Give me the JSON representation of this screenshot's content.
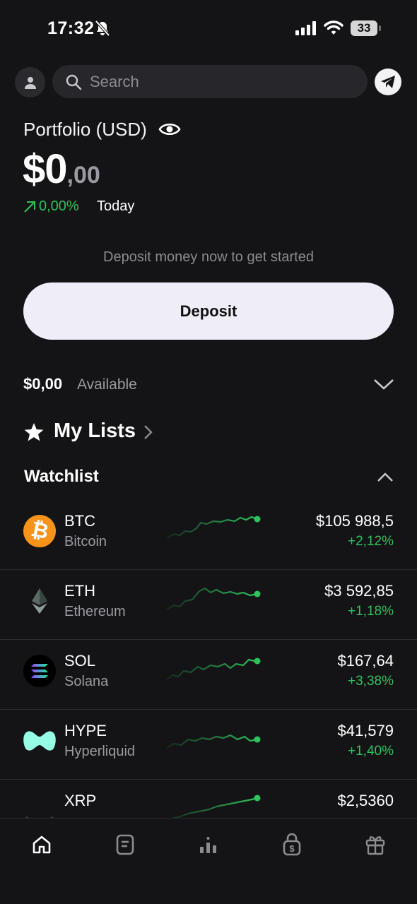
{
  "status_bar": {
    "time": "17:32",
    "battery": "33"
  },
  "search": {
    "placeholder": "Search"
  },
  "portfolio": {
    "title": "Portfolio (USD)",
    "balance_main": "$0",
    "balance_cents": ",00",
    "change": "0,00%",
    "period": "Today"
  },
  "deposit": {
    "hint": "Deposit money now to get started",
    "button_label": "Deposit"
  },
  "available": {
    "amount": "$0,00",
    "label": "Available"
  },
  "lists": {
    "title": "My Lists"
  },
  "watchlist": {
    "title": "Watchlist",
    "assets": [
      {
        "symbol": "BTC",
        "name": "Bitcoin",
        "price": "$105 988,5",
        "change": "+2,12%"
      },
      {
        "symbol": "ETH",
        "name": "Ethereum",
        "price": "$3 592,85",
        "change": "+1,18%"
      },
      {
        "symbol": "SOL",
        "name": "Solana",
        "price": "$167,64",
        "change": "+3,38%"
      },
      {
        "symbol": "HYPE",
        "name": "Hyperliquid",
        "price": "$41,579",
        "change": "+1,40%"
      },
      {
        "symbol": "XRP",
        "name": "",
        "price": "$2,5360",
        "change": ""
      }
    ]
  },
  "colors": {
    "positive": "#2fc35c",
    "background": "#141417",
    "accent_button": "#efeef8"
  },
  "nav": {
    "items": [
      {
        "icon": "home-icon"
      },
      {
        "icon": "orders-icon"
      },
      {
        "icon": "markets-icon"
      },
      {
        "icon": "earn-icon"
      },
      {
        "icon": "rewards-icon"
      }
    ]
  }
}
